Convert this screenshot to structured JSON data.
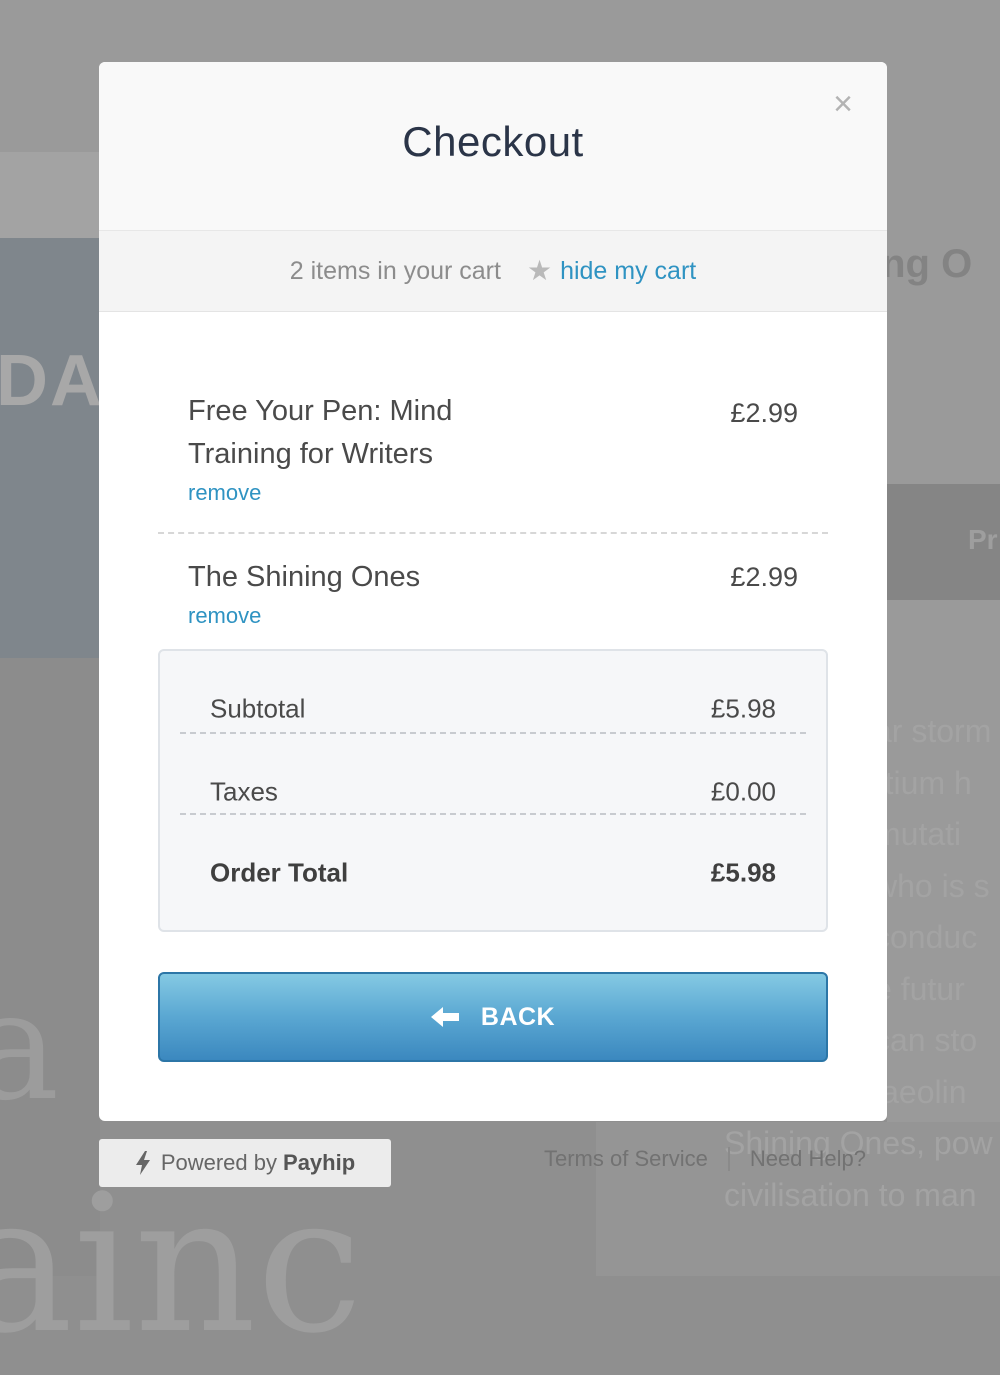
{
  "background": {
    "left_word": "DA",
    "cover_text": "ainc",
    "cover_letter": "a",
    "right_title": "ing O",
    "right_button": "Pr",
    "description_lines": [
      "ar storm",
      "rtium h",
      "mutati",
      "who is s",
      "conduc",
      "e futur",
      "can sto",
      "laeolin",
      "Shining Ones, pow",
      "civilisation to man"
    ]
  },
  "modal": {
    "title": "Checkout",
    "close_icon": "×"
  },
  "cart_bar": {
    "count_text": "2 items in your cart",
    "star_icon": "★",
    "hide_label": "hide my cart"
  },
  "items": [
    {
      "name": "Free Your Pen: Mind Training for Writers",
      "price": "£2.99",
      "remove_label": "remove"
    },
    {
      "name": "The Shining Ones",
      "price": "£2.99",
      "remove_label": "remove"
    }
  ],
  "totals": {
    "subtotal_label": "Subtotal",
    "subtotal_value": "£5.98",
    "taxes_label": "Taxes",
    "taxes_value": "£0.00",
    "order_total_label": "Order Total",
    "order_total_value": "£5.98"
  },
  "back_button": {
    "label": "BACK",
    "icon": "arrow-left-icon"
  },
  "footer": {
    "powered_prefix": "Powered by",
    "powered_brand": "Payhip",
    "terms_label": "Terms of Service",
    "help_label": "Need Help?"
  },
  "colors": {
    "accent_link": "#2f93c2",
    "button_top": "#84c9e3",
    "button_bottom": "#3b88bf",
    "title": "#2b3548"
  }
}
